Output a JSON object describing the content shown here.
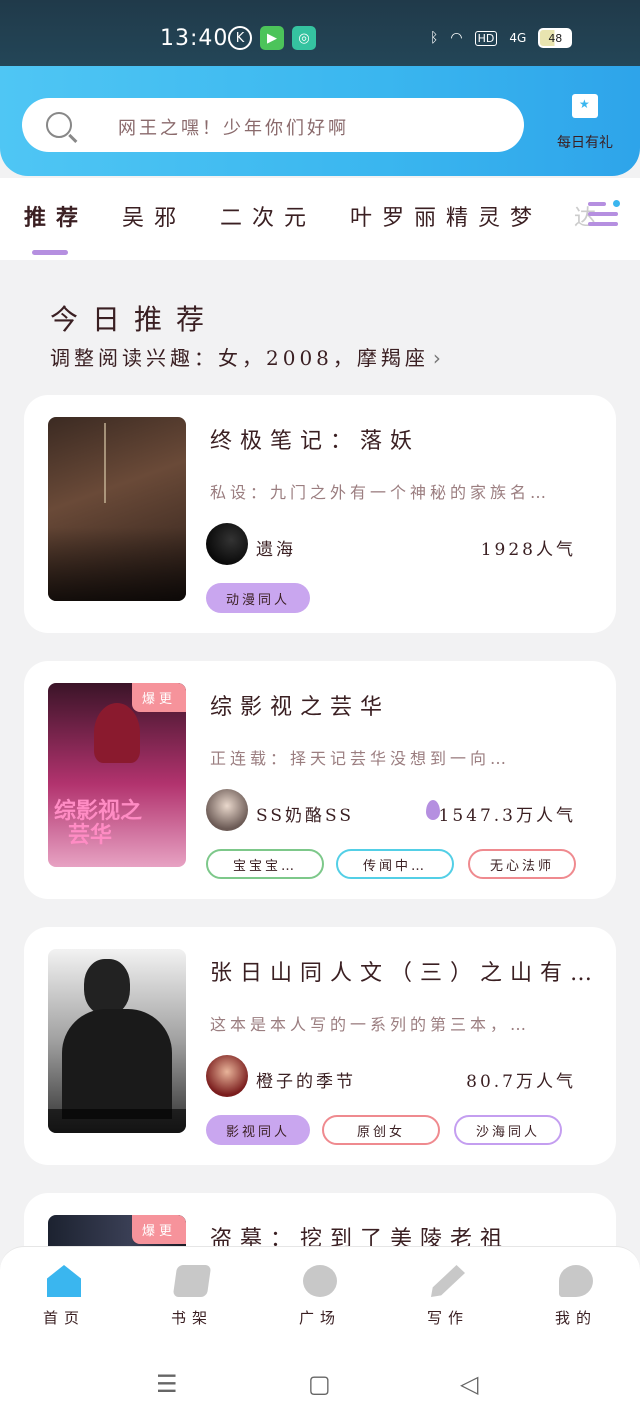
{
  "status_bar": {
    "time": "13:40",
    "app_icons": [
      "K",
      "▶",
      "◎"
    ],
    "hd": "HD",
    "network": "4G",
    "battery": "48"
  },
  "header": {
    "search_placeholder": "网王之嘿！少年你们好啊",
    "daily_sign_label": "每日有礼"
  },
  "tabs": [
    {
      "label": "推荐"
    },
    {
      "label": "吴邪"
    },
    {
      "label": "二次元"
    },
    {
      "label": "叶罗丽精灵梦"
    },
    {
      "label": "达"
    }
  ],
  "today": {
    "title": "今日推荐",
    "subtitle": "调整阅读兴趣：女，2008，摩羯座"
  },
  "books": [
    {
      "title": "终极笔记：落妖",
      "desc": "私设：九门之外有一个神秘的家族名…",
      "author": "遗海",
      "popularity": "1928人气",
      "badge": "",
      "tags": [
        "动漫同人"
      ]
    },
    {
      "title": "综影视之芸华",
      "desc": "正连载：择天记芸华没想到一向…",
      "author": "SS奶酪SS",
      "popularity": "1547.3万人气",
      "badge": "爆更",
      "tags": [
        "宝宝宝…",
        "传闻中…",
        "无心法师"
      ]
    },
    {
      "title": "张日山同人文（三）之山有…",
      "desc": "这本是本人写的一系列的第三本，…",
      "author": "橙子的季节",
      "popularity": "80.7万人气",
      "badge": "",
      "tags": [
        "影视同人",
        "原创女",
        "沙海同人"
      ]
    },
    {
      "title": "盗墓：挖到了美陵老祖",
      "desc": "",
      "author": "",
      "popularity": "",
      "badge": "爆更",
      "tags": []
    }
  ],
  "bottom_nav": [
    {
      "label": "首页",
      "icon": "home-icon"
    },
    {
      "label": "书架",
      "icon": "bookshelf-icon"
    },
    {
      "label": "广场",
      "icon": "planet-icon"
    },
    {
      "label": "写作",
      "icon": "pen-icon"
    },
    {
      "label": "我的",
      "icon": "chat-icon"
    }
  ],
  "colors": {
    "accent": "#3ab6ef",
    "purple": "#b58fe0",
    "badge": "#f6939b"
  }
}
